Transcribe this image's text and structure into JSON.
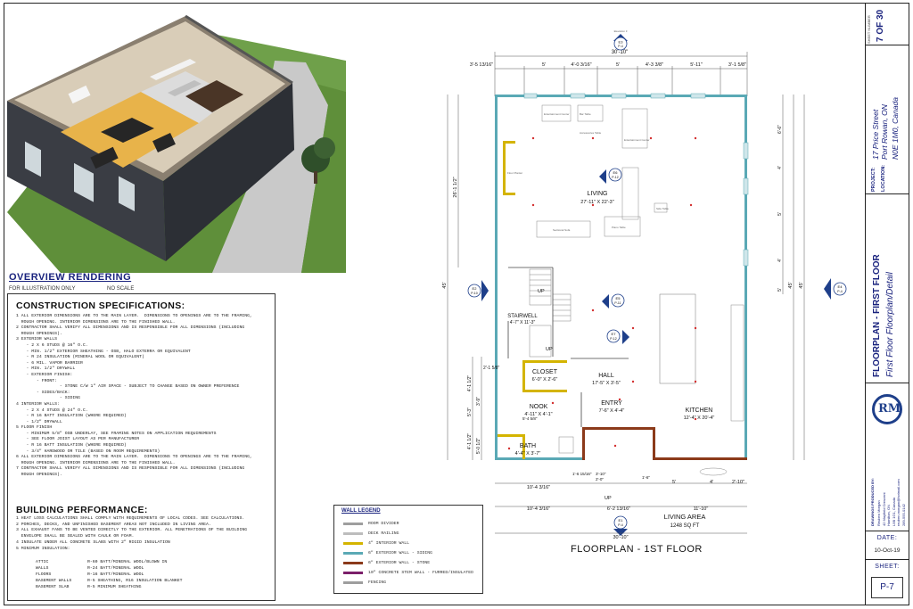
{
  "overview": {
    "title": "OVERVIEW RENDERING",
    "note_left": "FOR ILLUSTRATION ONLY",
    "note_right": "NO SCALE"
  },
  "construction": {
    "heading": "CONSTRUCTION SPECIFICATIONS:",
    "lines": [
      "1 ALL EXTERIOR DIMENSIONS ARE TO THE MAIN LAYER.  DIMENSIONS TO OPENINGS ARE TO THE FRAMING,",
      "  ROUGH OPENING. INTERIOR DIMENSIONS ARE TO THE FINISHED WALL.",
      "2 CONTRACTOR SHALL VERIFY ALL DIMENSIONS AND IS RESPONSIBLE FOR ALL DIMENSIONS (INCLUDING",
      "  ROUGH OPENINGS).",
      "3 EXTERIOR WALLS",
      "    - 2 X 6 STUDS @ 16\" O.C.",
      "    - MIN. 1/2\" EXTERIOR SHEATHING - OSB, HALO EXTERRA OR EQUIVALENT",
      "    - R 24 INSULATION (MINERAL WOOL OR EQUIVALENT)",
      "    - 6 MIL. VAPOR BARRIER",
      "    - MIN. 1/2\" DRYWALL",
      "    - EXTERIOR FINISH:",
      "        - FRONT:",
      "                 - STONE C/W 1\" AIR SPACE - SUBJECT TO CHANGE BASED ON OWNER PREFERENCE",
      "        - SIDES/BACK:",
      "                 - SIDING",
      "4 INTERIOR WALLS:",
      "    - 2 X 4 STUDS @ 24\" O.C.",
      "    - R 16 BATT INSULATION (WHERE REQUIRED)",
      "    - 1/2\" DRYWALL",
      "5 FLOOR FINISH",
      "    - MINIMUM 5/8\" OSB UNDERLAY, SEE FRAMING NOTES ON APPLICATION REQUIREMENTS",
      "    - SEE FLOOR JOIST LAYOUT AS PER MANUFACTURER",
      "    - R 16 BATT INSULATION (WHERE REQUIRED)",
      "    - 3/4\" HARDWOOD OR TILE (BASED ON ROOM REQUIREMENTS)",
      "6 ALL EXTERIOR DIMENSIONS ARE TO THE MAIN LAYER.  DIMENSIONS TO OPENINGS ARE TO THE FRAMING,",
      "  ROUGH OPENING. INTERIOR DIMENSIONS ARE TO THE FINISHED WALL.",
      "7 CONTRACTOR SHALL VERIFY ALL DIMENSIONS AND IS RESPONSIBLE FOR ALL DIMENSIONS (INCLUDING",
      "  ROUGH OPENINGS)."
    ]
  },
  "performance": {
    "heading": "BUILDING PERFORMANCE:",
    "lines": [
      "1 HEAT LOSS CALCULATIONS SHALL COMPLY WITH REQUIREMENTS OF LOCAL CODES. SEE CALCULATIONS.",
      "2 PORCHES, DECKS, AND UNFINISHED BASEMENT AREAS NOT INCLUDED IN LIVING AREA.",
      "3 ALL EXHAUST FANS TO BE VENTED DIRECTLY TO THE EXTERIOR. ALL PENETRATIONS OF THE BUILDING",
      "  ENVELOPE SHALL BE SEALED WITH CAULK OR FOAM.",
      "4 INSULATE UNDER ALL CONCRETE SLABS WITH 2\" RIGID INSULATION",
      "5 MINIMUM INSULATION:"
    ],
    "insulation": [
      {
        "item": "ATTIC",
        "value": "R-60 BATT/MINERAL WOOL/BLOWN IN"
      },
      {
        "item": "WALLS",
        "value": "R-24 BATT/MINERAL WOOL"
      },
      {
        "item": "FLOORS",
        "value": "R-16 BATT/MINERAL WOOL"
      },
      {
        "item": "BASEMENT WALLS",
        "value": "R-5 SHEATHING, R16 INSULATION BLANKET"
      },
      {
        "item": "BASEMENT SLAB",
        "value": "R-5 MINIMUM SHEATHING"
      }
    ]
  },
  "legend": {
    "title": "WALL LEGEND",
    "items": [
      {
        "label": "ROOM DIVIDER",
        "color": "#9e9e9e"
      },
      {
        "label": "DECK RAILING",
        "color": "#bdbdbd"
      },
      {
        "label": "4\" INTERIOR WALL",
        "color": "#d4b400"
      },
      {
        "label": "6\" EXTERIOR WALL - SIDING",
        "color": "#5aa9b5"
      },
      {
        "label": "6\" EXTERIOR WALL - STONE",
        "color": "#8b3a1a"
      },
      {
        "label": "10\" CONCRETE STEM WALL - FURRED/INSULATED",
        "color": "#7b1f6a"
      },
      {
        "label": "FENCING",
        "color": "#9e9e9e"
      }
    ]
  },
  "plan": {
    "title": "FLOORPLAN - 1ST FLOOR",
    "rooms": {
      "living": {
        "name": "LIVING",
        "dims": "27'-11\" X 22'-3\""
      },
      "stairwell": {
        "name": "STAIRWELL",
        "dims": "4'-7\" X 11'-3\""
      },
      "closet": {
        "name": "CLOSET",
        "dims": "6'-0\" X 2'-6\""
      },
      "hall": {
        "name": "HALL",
        "dims": "17'-5\" X 3'-5\""
      },
      "nook": {
        "name": "NOOK",
        "dims": "4'-11\" X 4'-1\""
      },
      "entry": {
        "name": "ENTRY",
        "dims": "7'-6\" X 4'-4\""
      },
      "kitchen": {
        "name": "KITCHEN",
        "dims": "12'-4\" X 20'-4\""
      },
      "bath": {
        "name": "BATH",
        "dims": "4'-4\" X 3'-7\""
      }
    },
    "living_area": {
      "label": "LIVING AREA",
      "value": "1248 SQ FT"
    },
    "dims": {
      "top_total": "30'-10\"",
      "top_segments": [
        "3'-5 13/16\"",
        "5'",
        "4'-0 3/16\"",
        "5'",
        "4'-3 3/8\"",
        "5'-11\"",
        "3'-1 5/8\""
      ],
      "bottom_total": "30'-10\"",
      "bottom_a": "10'-4 3/16\"",
      "bottom_b": "11'-10\"",
      "bottom_c": "10'-4 3/16\"",
      "bottom_d": "6'-2 13/16\"",
      "bottom_e": "5'",
      "bottom_f": "4'",
      "bottom_g": "2'-10\"",
      "left_total": "45'",
      "left_inner": "26'-1 1/2\"",
      "right_total": "45'",
      "right_inner": "45'",
      "right_segments": [
        "6'-6\"",
        "4'",
        "5'",
        "4'",
        "5'"
      ],
      "left_small": [
        "2'-1 5/8\"",
        "4'-1 1/2\"",
        "5'-3\"",
        "3'-9\"",
        "4'-1 1/2\"",
        "5'-4 5/8\"",
        "1'-6 15/16\"",
        "3'-10\"",
        "2'-0\"",
        "5'-0 1/2\"",
        "1'-6\""
      ],
      "stair_labels": [
        "UP",
        "UP",
        "UP"
      ]
    },
    "markers": [
      {
        "code": "E3",
        "sheet": "P-4",
        "label": "Elevation 3"
      },
      {
        "code": "E6",
        "sheet": "P-12",
        "label": ""
      },
      {
        "code": "E2",
        "sheet": "P-10",
        "label": ""
      },
      {
        "code": "E4",
        "sheet": "P-4",
        "label": ""
      },
      {
        "code": "E5",
        "sheet": "P-11",
        "label": ""
      },
      {
        "code": "E7",
        "sheet": "P-12",
        "label": ""
      },
      {
        "code": "E1",
        "sheet": "P-4",
        "label": ""
      }
    ],
    "furniture": [
      "Entertainment Center",
      "Bar Table",
      "Entertainment Center",
      "Piano Table",
      "Sectional Sofa",
      "Floor Planter",
      "Side Table",
      "Accessories Table"
    ]
  },
  "title_block": {
    "sheet_number_label": "SHEET NUMBER",
    "sheet_number": "7 OF 30",
    "project_label": "PROJECT:",
    "project": "17 Price Street",
    "location_label": "LOCATION:",
    "location_line1": "Port Rowan, ON",
    "location_line2": "N0E 1M0, Canada",
    "drawing_title": "FLOORPLAN - FIRST FLOOR",
    "drawing_subtitle": "First Floor Floorplan/Detail",
    "logo_text": "RM",
    "drawings_by": "DRAWINGS PRODUCED BY:",
    "designer_lines": [
      "Reuben Morgan",
      "42 Mayfield Crescent",
      "Hamilton, ON",
      "L9B 1G1, Canada",
      "reuben.morgan@hotmail.com",
      "289-555-0142"
    ],
    "date_label": "DATE:",
    "date": "10-Oct-19",
    "sheet_label": "SHEET:",
    "sheet": "P-7"
  },
  "colors": {
    "accent": "#1a237e",
    "siding_wall": "#5aa9b5",
    "stone_wall": "#8b3a1a",
    "interior_wall": "#d4b400",
    "marker_blue": "#1e3f8a"
  }
}
